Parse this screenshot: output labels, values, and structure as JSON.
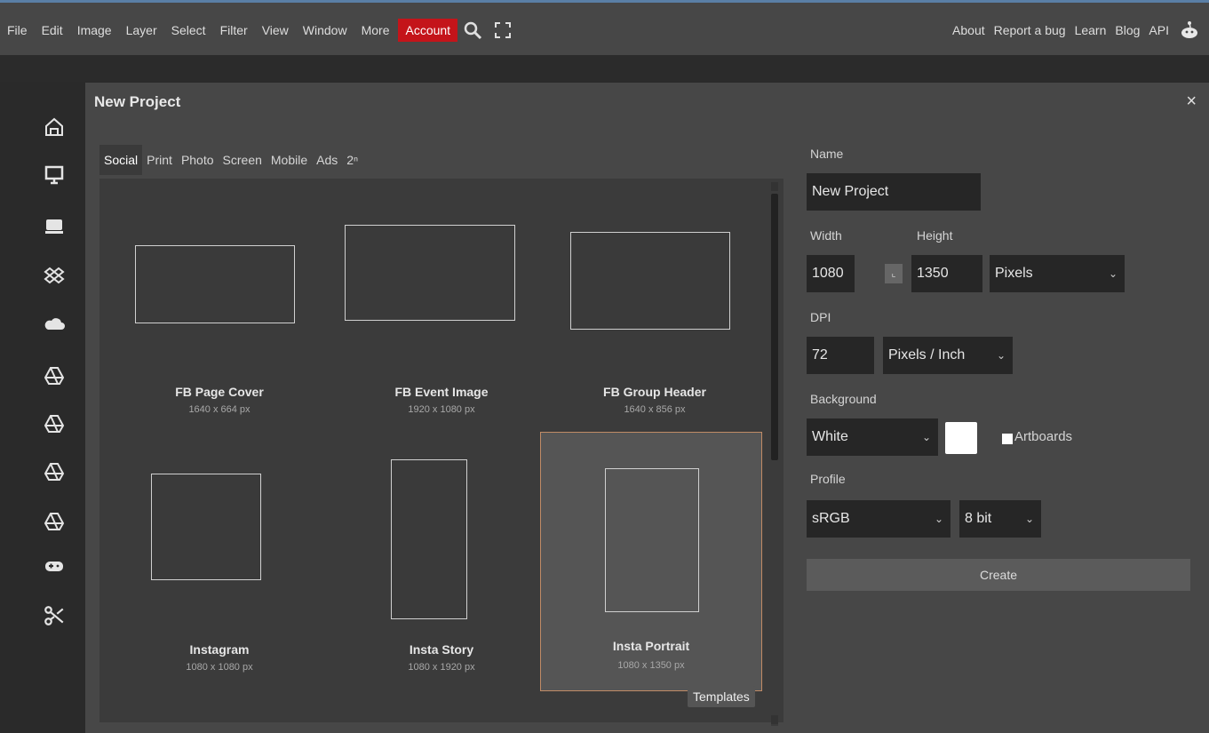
{
  "menu": {
    "items": [
      "File",
      "Edit",
      "Image",
      "Layer",
      "Select",
      "Filter",
      "View",
      "Window",
      "More"
    ],
    "account": "Account",
    "right": [
      "About",
      "Report a bug",
      "Learn",
      "Blog",
      "API"
    ]
  },
  "dialog": {
    "title": "New Project",
    "close": "×",
    "tabs": [
      "Social",
      "Print",
      "Photo",
      "Screen",
      "Mobile",
      "Ads",
      "2ⁿ"
    ],
    "templates": [
      {
        "name": "FB Page Cover",
        "size": "1640 x 664 px"
      },
      {
        "name": "FB Event Image",
        "size": "1920 x 1080 px"
      },
      {
        "name": "FB Group Header",
        "size": "1640 x 856 px"
      },
      {
        "name": "Instagram",
        "size": "1080 x 1080 px"
      },
      {
        "name": "Insta Story",
        "size": "1080 x 1920 px"
      },
      {
        "name": "Insta Portrait",
        "size": "1080 x 1350 px"
      }
    ],
    "tooltip": "Templates",
    "form": {
      "name_label": "Name",
      "name_value": "New Project",
      "width_label": "Width",
      "height_label": "Height",
      "width_value": "1080",
      "height_value": "1350",
      "unit": "Pixels",
      "dpi_label": "DPI",
      "dpi_value": "72",
      "dpi_unit": "Pixels / Inch",
      "background_label": "Background",
      "background_value": "White",
      "artboards_label": "Artboards",
      "profile_label": "Profile",
      "profile_value": "sRGB",
      "bit_value": "8 bit",
      "create": "Create"
    }
  },
  "colors": {
    "accent": "#c4141a",
    "dialog_bg": "#474747",
    "selected_border": "#c08b66"
  }
}
